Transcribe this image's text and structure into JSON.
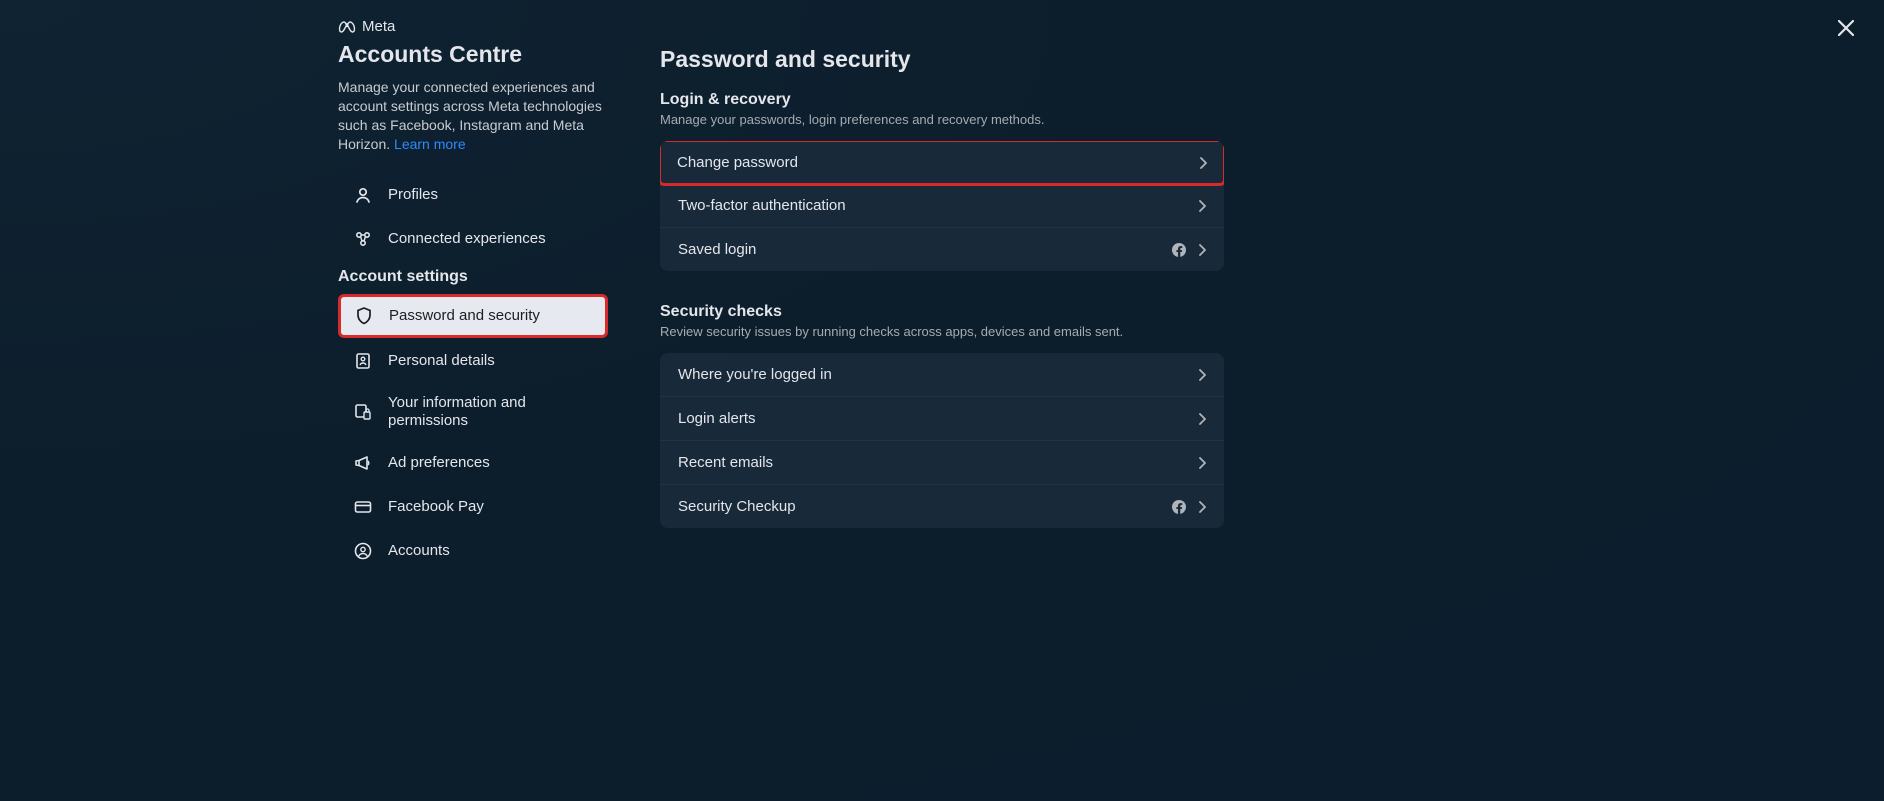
{
  "brand": {
    "name": "Meta"
  },
  "sidebar": {
    "title": "Accounts Centre",
    "description": "Manage your connected experiences and account settings across Meta technologies such as Facebook, Instagram and Meta Horizon. ",
    "learn_more": "Learn more",
    "top_items": [
      {
        "label": "Profiles",
        "icon": "person-icon"
      },
      {
        "label": "Connected experiences",
        "icon": "connected-icon"
      }
    ],
    "group_label": "Account settings",
    "settings_items": [
      {
        "label": "Password and security",
        "icon": "shield-icon",
        "active": true
      },
      {
        "label": "Personal details",
        "icon": "id-card-icon"
      },
      {
        "label": "Your information and permissions",
        "icon": "permissions-icon"
      },
      {
        "label": "Ad preferences",
        "icon": "megaphone-icon"
      },
      {
        "label": "Facebook Pay",
        "icon": "card-icon"
      },
      {
        "label": "Accounts",
        "icon": "user-circle-icon"
      }
    ]
  },
  "main": {
    "title": "Password and security",
    "sections": [
      {
        "title": "Login & recovery",
        "desc": "Manage your passwords, login preferences and recovery methods.",
        "items": [
          {
            "label": "Change password",
            "highlighted": true
          },
          {
            "label": "Two-factor authentication"
          },
          {
            "label": "Saved login",
            "fb_icon": true
          }
        ]
      },
      {
        "title": "Security checks",
        "desc": "Review security issues by running checks across apps, devices and emails sent.",
        "items": [
          {
            "label": "Where you're logged in"
          },
          {
            "label": "Login alerts"
          },
          {
            "label": "Recent emails"
          },
          {
            "label": "Security Checkup",
            "fb_icon": true
          }
        ]
      }
    ]
  }
}
